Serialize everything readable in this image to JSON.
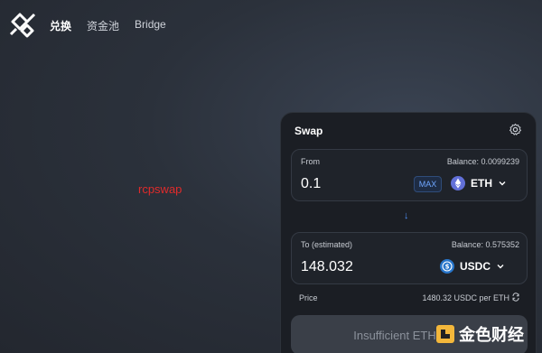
{
  "nav": {
    "items": [
      "兑换",
      "资金池",
      "Bridge"
    ]
  },
  "annotation": {
    "text": "rcpswap"
  },
  "swap": {
    "title": "Swap",
    "from": {
      "label": "From",
      "balance": "Balance: 0.0099239",
      "amount": "0.1",
      "max_label": "MAX",
      "token": "ETH"
    },
    "to": {
      "label": "To (estimated)",
      "balance": "Balance: 0.575352",
      "amount": "148.032",
      "token": "USDC"
    },
    "price": {
      "label": "Price",
      "value": "1480.32 USDC per ETH"
    },
    "action_label": "Insufficient ETH"
  },
  "watermark": {
    "text": "金色财经"
  },
  "colors": {
    "accent": "#4f8ff7",
    "annotation": "#e02b2b",
    "card": "#1b1e24"
  }
}
